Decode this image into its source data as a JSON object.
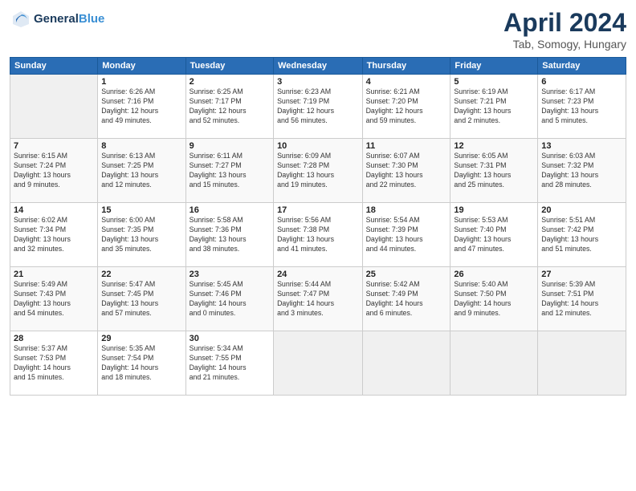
{
  "header": {
    "logo_line1": "General",
    "logo_line2": "Blue",
    "title": "April 2024",
    "subtitle": "Tab, Somogy, Hungary"
  },
  "days_of_week": [
    "Sunday",
    "Monday",
    "Tuesday",
    "Wednesday",
    "Thursday",
    "Friday",
    "Saturday"
  ],
  "weeks": [
    [
      {
        "day": "",
        "info": ""
      },
      {
        "day": "1",
        "info": "Sunrise: 6:26 AM\nSunset: 7:16 PM\nDaylight: 12 hours\nand 49 minutes."
      },
      {
        "day": "2",
        "info": "Sunrise: 6:25 AM\nSunset: 7:17 PM\nDaylight: 12 hours\nand 52 minutes."
      },
      {
        "day": "3",
        "info": "Sunrise: 6:23 AM\nSunset: 7:19 PM\nDaylight: 12 hours\nand 56 minutes."
      },
      {
        "day": "4",
        "info": "Sunrise: 6:21 AM\nSunset: 7:20 PM\nDaylight: 12 hours\nand 59 minutes."
      },
      {
        "day": "5",
        "info": "Sunrise: 6:19 AM\nSunset: 7:21 PM\nDaylight: 13 hours\nand 2 minutes."
      },
      {
        "day": "6",
        "info": "Sunrise: 6:17 AM\nSunset: 7:23 PM\nDaylight: 13 hours\nand 5 minutes."
      }
    ],
    [
      {
        "day": "7",
        "info": "Sunrise: 6:15 AM\nSunset: 7:24 PM\nDaylight: 13 hours\nand 9 minutes."
      },
      {
        "day": "8",
        "info": "Sunrise: 6:13 AM\nSunset: 7:25 PM\nDaylight: 13 hours\nand 12 minutes."
      },
      {
        "day": "9",
        "info": "Sunrise: 6:11 AM\nSunset: 7:27 PM\nDaylight: 13 hours\nand 15 minutes."
      },
      {
        "day": "10",
        "info": "Sunrise: 6:09 AM\nSunset: 7:28 PM\nDaylight: 13 hours\nand 19 minutes."
      },
      {
        "day": "11",
        "info": "Sunrise: 6:07 AM\nSunset: 7:30 PM\nDaylight: 13 hours\nand 22 minutes."
      },
      {
        "day": "12",
        "info": "Sunrise: 6:05 AM\nSunset: 7:31 PM\nDaylight: 13 hours\nand 25 minutes."
      },
      {
        "day": "13",
        "info": "Sunrise: 6:03 AM\nSunset: 7:32 PM\nDaylight: 13 hours\nand 28 minutes."
      }
    ],
    [
      {
        "day": "14",
        "info": "Sunrise: 6:02 AM\nSunset: 7:34 PM\nDaylight: 13 hours\nand 32 minutes."
      },
      {
        "day": "15",
        "info": "Sunrise: 6:00 AM\nSunset: 7:35 PM\nDaylight: 13 hours\nand 35 minutes."
      },
      {
        "day": "16",
        "info": "Sunrise: 5:58 AM\nSunset: 7:36 PM\nDaylight: 13 hours\nand 38 minutes."
      },
      {
        "day": "17",
        "info": "Sunrise: 5:56 AM\nSunset: 7:38 PM\nDaylight: 13 hours\nand 41 minutes."
      },
      {
        "day": "18",
        "info": "Sunrise: 5:54 AM\nSunset: 7:39 PM\nDaylight: 13 hours\nand 44 minutes."
      },
      {
        "day": "19",
        "info": "Sunrise: 5:53 AM\nSunset: 7:40 PM\nDaylight: 13 hours\nand 47 minutes."
      },
      {
        "day": "20",
        "info": "Sunrise: 5:51 AM\nSunset: 7:42 PM\nDaylight: 13 hours\nand 51 minutes."
      }
    ],
    [
      {
        "day": "21",
        "info": "Sunrise: 5:49 AM\nSunset: 7:43 PM\nDaylight: 13 hours\nand 54 minutes."
      },
      {
        "day": "22",
        "info": "Sunrise: 5:47 AM\nSunset: 7:45 PM\nDaylight: 13 hours\nand 57 minutes."
      },
      {
        "day": "23",
        "info": "Sunrise: 5:45 AM\nSunset: 7:46 PM\nDaylight: 14 hours\nand 0 minutes."
      },
      {
        "day": "24",
        "info": "Sunrise: 5:44 AM\nSunset: 7:47 PM\nDaylight: 14 hours\nand 3 minutes."
      },
      {
        "day": "25",
        "info": "Sunrise: 5:42 AM\nSunset: 7:49 PM\nDaylight: 14 hours\nand 6 minutes."
      },
      {
        "day": "26",
        "info": "Sunrise: 5:40 AM\nSunset: 7:50 PM\nDaylight: 14 hours\nand 9 minutes."
      },
      {
        "day": "27",
        "info": "Sunrise: 5:39 AM\nSunset: 7:51 PM\nDaylight: 14 hours\nand 12 minutes."
      }
    ],
    [
      {
        "day": "28",
        "info": "Sunrise: 5:37 AM\nSunset: 7:53 PM\nDaylight: 14 hours\nand 15 minutes."
      },
      {
        "day": "29",
        "info": "Sunrise: 5:35 AM\nSunset: 7:54 PM\nDaylight: 14 hours\nand 18 minutes."
      },
      {
        "day": "30",
        "info": "Sunrise: 5:34 AM\nSunset: 7:55 PM\nDaylight: 14 hours\nand 21 minutes."
      },
      {
        "day": "",
        "info": ""
      },
      {
        "day": "",
        "info": ""
      },
      {
        "day": "",
        "info": ""
      },
      {
        "day": "",
        "info": ""
      }
    ]
  ]
}
